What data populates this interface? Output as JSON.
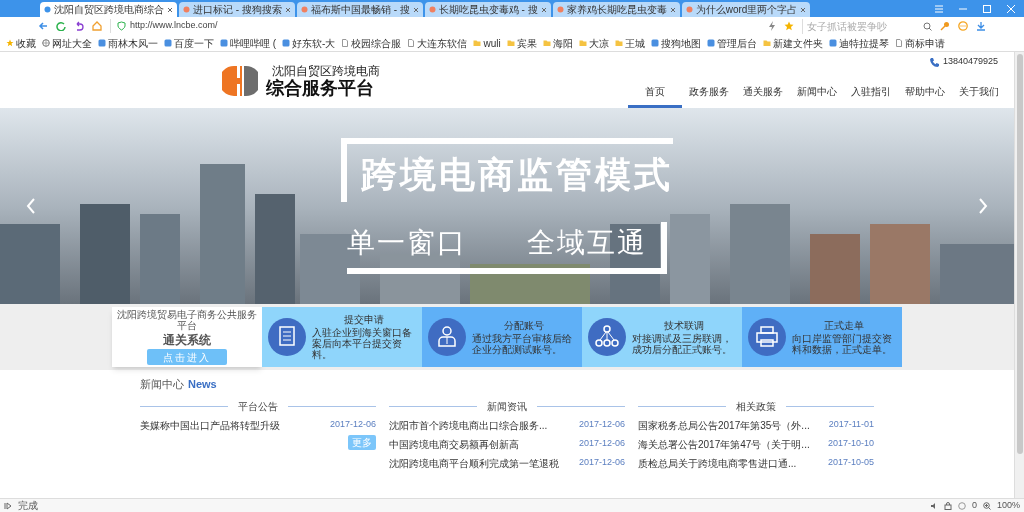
{
  "tabs": [
    {
      "label": "沈阳自贸区跨境电商综合",
      "selected": true
    },
    {
      "label": "进口标记 - 搜狗搜索",
      "selected": false
    },
    {
      "label": "福布斯中国最畅销 - 搜",
      "selected": false
    },
    {
      "label": "长期吃昆虫变毒鸡 - 搜",
      "selected": false
    },
    {
      "label": "家养鸡长期吃昆虫变毒",
      "selected": false
    },
    {
      "label": "为什么word里两个字占",
      "selected": false
    }
  ],
  "address": {
    "url": "http://www.lncbe.com/",
    "search_placeholder": "女子抓话被罢争吵"
  },
  "bookmarks": [
    {
      "label": "收藏",
      "kind": "star"
    },
    {
      "label": "网址大全",
      "kind": "globe"
    },
    {
      "label": "雨林木风一",
      "kind": "site"
    },
    {
      "label": "百度一下",
      "kind": "site"
    },
    {
      "label": "哔哩哔哩 (",
      "kind": "site"
    },
    {
      "label": "好东软-大",
      "kind": "site"
    },
    {
      "label": "校园综合服",
      "kind": "page"
    },
    {
      "label": "大连东软信",
      "kind": "page"
    },
    {
      "label": "wuli",
      "kind": "folder"
    },
    {
      "label": "宾果",
      "kind": "folder"
    },
    {
      "label": "海阳",
      "kind": "folder"
    },
    {
      "label": "大凉",
      "kind": "folder"
    },
    {
      "label": "王城",
      "kind": "folder"
    },
    {
      "label": "搜狗地图",
      "kind": "site"
    },
    {
      "label": "管理后台",
      "kind": "site"
    },
    {
      "label": "新建文件夹",
      "kind": "folder"
    },
    {
      "label": "迪特拉提琴",
      "kind": "site"
    },
    {
      "label": "商标申请",
      "kind": "page"
    }
  ],
  "header": {
    "logo_line1": "沈阳自贸区跨境电商",
    "logo_line2": "综合服务平台",
    "phone": "13840479925",
    "nav": [
      {
        "label": "首页",
        "selected": true
      },
      {
        "label": "政务服务",
        "selected": false
      },
      {
        "label": "通关服务",
        "selected": false
      },
      {
        "label": "新闻中心",
        "selected": false
      },
      {
        "label": "入驻指引",
        "selected": false
      },
      {
        "label": "帮助中心",
        "selected": false
      },
      {
        "label": "关于我们",
        "selected": false
      }
    ]
  },
  "banner": {
    "headline": "跨境电商监管模式",
    "sub_left": "单一窗口",
    "sub_right": "全域互通"
  },
  "services": {
    "card": {
      "subtitle": "沈阳跨境贸易电子商务公共服务平台",
      "title": "通关系统",
      "button": "点击进入"
    },
    "steps": [
      {
        "title": "提交申请",
        "text": "入驻企业到海关窗口备案后向本平台提交资料。",
        "kind": "document"
      },
      {
        "title": "分配账号",
        "text": "通过我方平台审核后给企业分配测试账号。",
        "kind": "person"
      },
      {
        "title": "技术联调",
        "text": "对接调试及三房联调，成功后分配正式账号。",
        "kind": "network"
      },
      {
        "title": "正式走单",
        "text": "向口岸监管部门提交资料和数据，正式走单。",
        "kind": "printer"
      }
    ]
  },
  "news": {
    "title": "新闻中心",
    "title_en": "News",
    "columns": [
      {
        "title": "平台公告",
        "more": "更多",
        "items": [
          {
            "text": "美媒称中国出口产品将转型升级",
            "date": "2017-12-06"
          }
        ]
      },
      {
        "title": "新闻资讯",
        "items": [
          {
            "text": "沈阳市首个跨境电商出口综合服务...",
            "date": "2017-12-06"
          },
          {
            "text": "中国跨境电商交易额再创新高",
            "date": "2017-12-06"
          },
          {
            "text": "沈阳跨境电商平台顺利完成第一笔退税",
            "date": "2017-12-06"
          }
        ]
      },
      {
        "title": "相关政策",
        "items": [
          {
            "text": "国家税务总局公告2017年第35号（外...",
            "date": "2017-11-01"
          },
          {
            "text": "海关总署公告2017年第47号（关于明...",
            "date": "2017-10-10"
          },
          {
            "text": "质检总局关于跨境电商零售进口通...",
            "date": "2017-10-05"
          }
        ]
      }
    ]
  },
  "status_bar": {
    "text": "完成",
    "count": "0",
    "zoom": "100%"
  }
}
